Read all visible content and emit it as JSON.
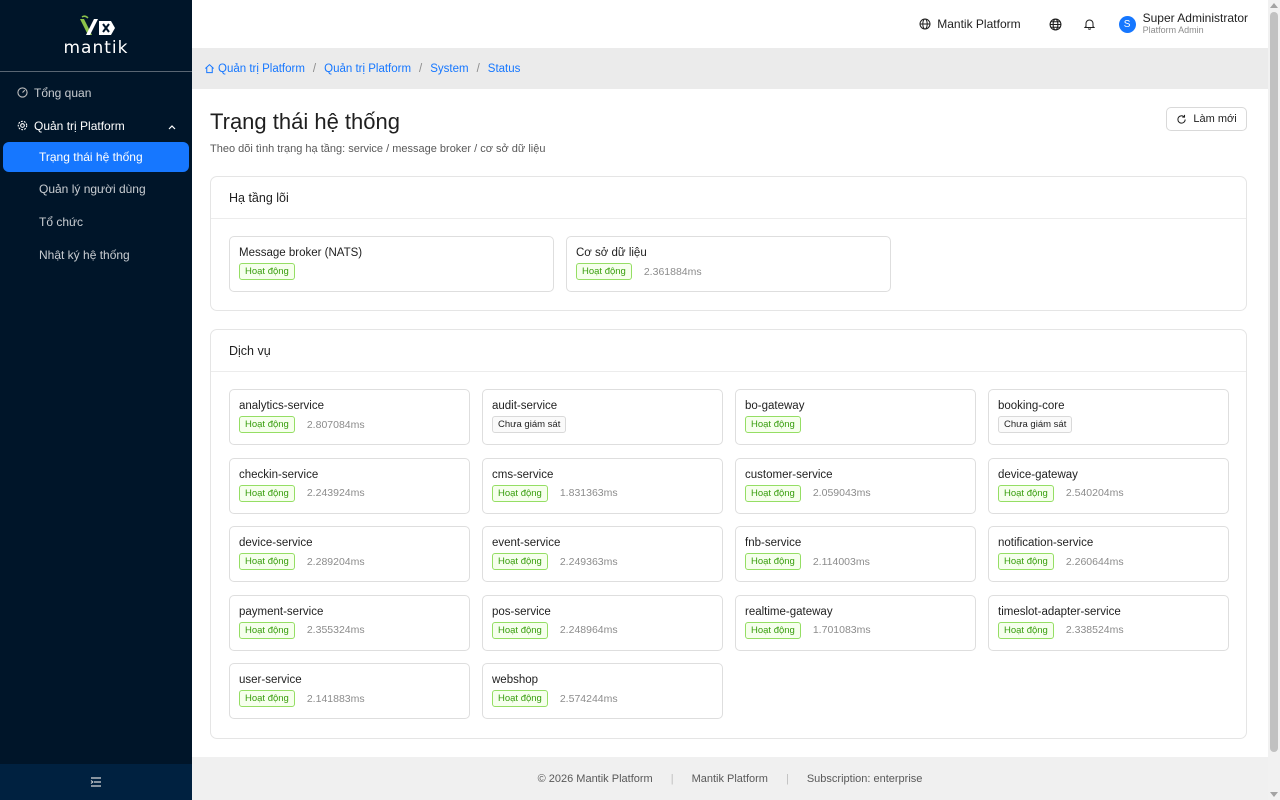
{
  "brand": {
    "logo_text": "mantik"
  },
  "sidebar": {
    "overview": "Tổng quan",
    "group": "Quản trị Platform",
    "items": [
      "Trạng thái hệ thống",
      "Quản lý người dùng",
      "Tổ chức",
      "Nhật ký hệ thống"
    ],
    "active_index": 0
  },
  "header": {
    "platform": "Mantik Platform",
    "user_initial": "S",
    "user_name": "Super Administrator",
    "user_role": "Platform Admin"
  },
  "breadcrumb": [
    "Quản trị Platform",
    "Quản trị Platform",
    "System",
    "Status"
  ],
  "page": {
    "title": "Trạng thái hệ thống",
    "subtitle": "Theo dõi tình trạng hạ tầng: service / message broker / cơ sở dữ liệu",
    "refresh_label": "Làm mới"
  },
  "core": {
    "title": "Hạ tầng lõi",
    "items": [
      {
        "name": "Message broker (NATS)",
        "status": "Hoạt động",
        "latency": ""
      },
      {
        "name": "Cơ sở dữ liệu",
        "status": "Hoạt động",
        "latency": "2.361884ms"
      }
    ]
  },
  "services": {
    "title": "Dịch vụ",
    "items": [
      {
        "name": "analytics-service",
        "status": "Hoạt động",
        "ok": true,
        "latency": "2.807084ms"
      },
      {
        "name": "audit-service",
        "status": "Chưa giám sát",
        "ok": false,
        "latency": ""
      },
      {
        "name": "bo-gateway",
        "status": "Hoạt động",
        "ok": true,
        "latency": ""
      },
      {
        "name": "booking-core",
        "status": "Chưa giám sát",
        "ok": false,
        "latency": ""
      },
      {
        "name": "checkin-service",
        "status": "Hoạt động",
        "ok": true,
        "latency": "2.243924ms"
      },
      {
        "name": "cms-service",
        "status": "Hoạt động",
        "ok": true,
        "latency": "1.831363ms"
      },
      {
        "name": "customer-service",
        "status": "Hoạt động",
        "ok": true,
        "latency": "2.059043ms"
      },
      {
        "name": "device-gateway",
        "status": "Hoạt động",
        "ok": true,
        "latency": "2.540204ms"
      },
      {
        "name": "device-service",
        "status": "Hoạt động",
        "ok": true,
        "latency": "2.289204ms"
      },
      {
        "name": "event-service",
        "status": "Hoạt động",
        "ok": true,
        "latency": "2.249363ms"
      },
      {
        "name": "fnb-service",
        "status": "Hoạt động",
        "ok": true,
        "latency": "2.114003ms"
      },
      {
        "name": "notification-service",
        "status": "Hoạt động",
        "ok": true,
        "latency": "2.260644ms"
      },
      {
        "name": "payment-service",
        "status": "Hoạt động",
        "ok": true,
        "latency": "2.355324ms"
      },
      {
        "name": "pos-service",
        "status": "Hoạt động",
        "ok": true,
        "latency": "2.248964ms"
      },
      {
        "name": "realtime-gateway",
        "status": "Hoạt động",
        "ok": true,
        "latency": "1.701083ms"
      },
      {
        "name": "timeslot-adapter-service",
        "status": "Hoạt động",
        "ok": true,
        "latency": "2.338524ms"
      },
      {
        "name": "user-service",
        "status": "Hoạt động",
        "ok": true,
        "latency": "2.141883ms"
      },
      {
        "name": "webshop",
        "status": "Hoạt động",
        "ok": true,
        "latency": "2.574244ms"
      }
    ]
  },
  "footer": {
    "copyright": "© 2026 Mantik Platform",
    "platform": "Mantik Platform",
    "subscription": "Subscription: enterprise"
  },
  "colors": {
    "sidebar": "#001529",
    "accent": "#1677ff",
    "ok": "#389e0d"
  }
}
